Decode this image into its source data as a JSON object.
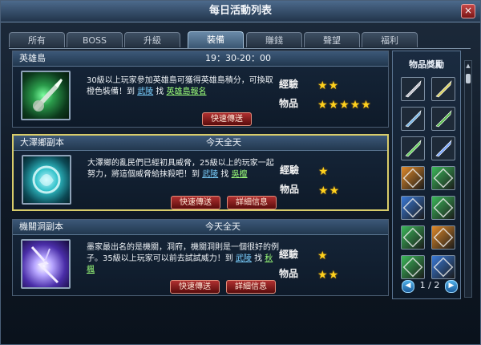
{
  "window": {
    "title": "每日活動列表",
    "close_label": "×"
  },
  "tabs": [
    {
      "label": "所有"
    },
    {
      "label": "BOSS"
    },
    {
      "label": "升級"
    },
    {
      "label": "裝備"
    },
    {
      "label": "賺錢"
    },
    {
      "label": "聲望"
    },
    {
      "label": "福利"
    }
  ],
  "activities": [
    {
      "name": "英雄島",
      "time": "19：30-20：00",
      "desc_pre": "30級以上玩家參加英雄島可獲得英雄島積分，可換取橙色裝備！到 ",
      "map": "武陵",
      "desc_mid": " 找 ",
      "npc": "英雄島報名",
      "desc_post": "",
      "btn_teleport": "快速傳送",
      "exp_label": "經驗",
      "item_label": "物品",
      "exp_stars": 2,
      "item_stars": 5
    },
    {
      "name": "大澤鄉副本",
      "time": "今天全天",
      "desc_pre": "大澤鄉的亂民們已經初具威脅，25級以上的玩家一起努力，將這個威脅給抹殺吧！到 ",
      "map": "武陵",
      "desc_mid": " 找 ",
      "npc": "吳檀",
      "desc_post": "",
      "btn_teleport": "快速傳送",
      "btn_detail": "詳細信息",
      "exp_label": "經驗",
      "item_label": "物品",
      "exp_stars": 1,
      "item_stars": 2
    },
    {
      "name": "機關洞副本",
      "time": "今天全天",
      "desc_pre": "墨家最出名的是機關，洞府，機關洞則是一個很好的例子。35級以上玩家可以前去試試威力！到 ",
      "map": "武陵",
      "desc_mid": " 找 ",
      "npc": "秋楓",
      "desc_post": "",
      "btn_teleport": "快速傳送",
      "btn_detail": "詳細信息",
      "exp_label": "經驗",
      "item_label": "物品",
      "exp_stars": 1,
      "item_stars": 2
    }
  ],
  "rewards": {
    "title": "物品獎勵",
    "items": [
      {
        "icon": "dagger-icon",
        "color": "#c8c8d0"
      },
      {
        "icon": "crossed-blades-icon",
        "color": "#d8d060"
      },
      {
        "icon": "curved-blade-icon",
        "color": "#7ab8e8"
      },
      {
        "icon": "hook-sword-icon",
        "color": "#5ec050"
      },
      {
        "icon": "jade-staff-icon",
        "color": "#6ad060"
      },
      {
        "icon": "ice-blade-icon",
        "color": "#7aa8ff"
      },
      {
        "icon": "orange-scroll-icon",
        "color": "#e08a2a"
      },
      {
        "icon": "green-scroll-icon",
        "color": "#3cb85a"
      },
      {
        "icon": "blue-scroll-icon",
        "color": "#3a7ad8"
      },
      {
        "icon": "green-scroll-icon",
        "color": "#3cb85a"
      },
      {
        "icon": "green-scroll-icon",
        "color": "#3cb85a"
      },
      {
        "icon": "orange-scroll-icon",
        "color": "#e08a2a"
      },
      {
        "icon": "green-scroll-icon",
        "color": "#3cb85a"
      },
      {
        "icon": "blue-scroll-icon",
        "color": "#3a7ad8"
      }
    ],
    "page_label": "1 / 2"
  },
  "footer": {
    "hint": ""
  }
}
